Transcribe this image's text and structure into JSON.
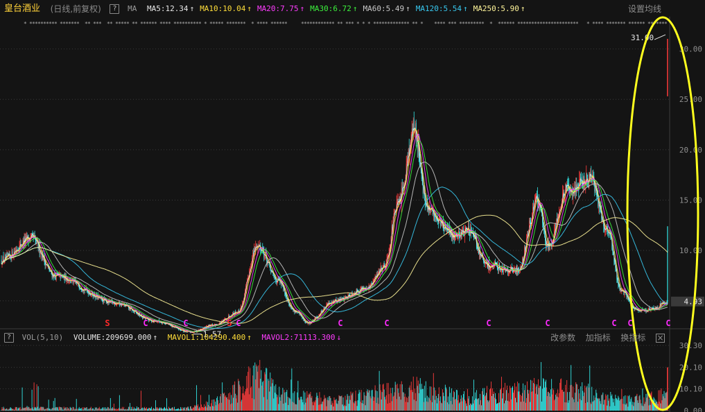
{
  "header": {
    "stock_name": "皇台酒业",
    "sub_label": "(日线,前复权)",
    "help_icon_text": "?",
    "ma_label": "MA",
    "settings_label": "设置均线"
  },
  "ma_legend": [
    {
      "text": "MA5:12.34",
      "arrow": "↑",
      "color": "#e8e8e8"
    },
    {
      "text": "MA10:10.04",
      "arrow": "↑",
      "color": "#ffde3a"
    },
    {
      "text": "MA20:7.75",
      "arrow": "↑",
      "color": "#ff3cff"
    },
    {
      "text": "MA30:6.72",
      "arrow": "↑",
      "color": "#3cf03c"
    },
    {
      "text": "MA60:5.49",
      "arrow": "↑",
      "color": "#c8c8c8"
    },
    {
      "text": "MA120:5.54",
      "arrow": "↑",
      "color": "#38c9f0"
    },
    {
      "text": "MA250:5.90",
      "arrow": "↑",
      "color": "#fff59a"
    }
  ],
  "volume_header": {
    "help_icon_text": "?",
    "label": "VOL(5,10)",
    "volume": {
      "text": "VOLUME:209699.000",
      "arrow": "↑",
      "color": "#e8e8e8"
    },
    "mavol1": {
      "text": "MAVOL1:104290.400",
      "arrow": "↑",
      "color": "#ffde3a"
    },
    "mavol2": {
      "text": "MAVOL2:71113.300",
      "arrow": "↓",
      "color": "#ff3cff"
    },
    "buttons": [
      "改参数",
      "加指标",
      "换指标"
    ],
    "close_text": "×"
  },
  "price_axis": {
    "min": 2.5,
    "max": 33,
    "ticks": [
      "30.00",
      "25.00",
      "20.00",
      "15.00",
      "10.00",
      "5.00"
    ],
    "tick_values": [
      30,
      25,
      20,
      15,
      10,
      5
    ]
  },
  "annotations": {
    "high_label": "31.00",
    "low_label": "1.57",
    "current_price": "4.93"
  },
  "event_markers": [
    "S",
    "C",
    "C",
    "S",
    "C",
    "C",
    "C",
    "C",
    "C",
    "C",
    "C",
    "C"
  ],
  "volume_axis": {
    "ticks": [
      "30.30",
      "20.10",
      "10.10",
      "0.00"
    ],
    "tick_values": [
      30.3,
      20.1,
      10.1,
      0.0
    ]
  },
  "colors": {
    "background": "#141414",
    "up": "#ff3d3d",
    "down": "#34e8e8",
    "grid": "#3a3a3a",
    "highlight_ellipse": "#ffff1e",
    "axis_text": "#8f8f8f"
  },
  "chart_data": {
    "type": "candlestick",
    "title": "皇台酒业 (日线,前复权)",
    "ylim": [
      2.5,
      33
    ],
    "price_keypoints": [
      {
        "t": 0.0,
        "p": 9.0
      },
      {
        "t": 0.045,
        "p": 11.2
      },
      {
        "t": 0.08,
        "p": 7.5
      },
      {
        "t": 0.17,
        "p": 4.8
      },
      {
        "t": 0.23,
        "p": 3.0
      },
      {
        "t": 0.285,
        "p": 1.9
      },
      {
        "t": 0.32,
        "p": 2.6
      },
      {
        "t": 0.355,
        "p": 3.9
      },
      {
        "t": 0.385,
        "p": 10.5
      },
      {
        "t": 0.415,
        "p": 7.0
      },
      {
        "t": 0.44,
        "p": 4.0
      },
      {
        "t": 0.46,
        "p": 2.8
      },
      {
        "t": 0.5,
        "p": 5.0
      },
      {
        "t": 0.55,
        "p": 6.3
      },
      {
        "t": 0.575,
        "p": 8.5
      },
      {
        "t": 0.595,
        "p": 14.5
      },
      {
        "t": 0.62,
        "p": 22.0
      },
      {
        "t": 0.64,
        "p": 14.0
      },
      {
        "t": 0.68,
        "p": 11.5
      },
      {
        "t": 0.7,
        "p": 12.0
      },
      {
        "t": 0.73,
        "p": 8.5
      },
      {
        "t": 0.775,
        "p": 8.0
      },
      {
        "t": 0.805,
        "p": 15.0
      },
      {
        "t": 0.82,
        "p": 10.5
      },
      {
        "t": 0.85,
        "p": 16.0
      },
      {
        "t": 0.885,
        "p": 17.0
      },
      {
        "t": 0.91,
        "p": 12.0
      },
      {
        "t": 0.93,
        "p": 6.0
      },
      {
        "t": 0.955,
        "p": 4.0
      },
      {
        "t": 0.98,
        "p": 4.2
      },
      {
        "t": 0.997,
        "p": 4.9
      }
    ],
    "volume_keypoints": [
      {
        "t": 0.0,
        "v": 1
      },
      {
        "t": 0.28,
        "v": 1
      },
      {
        "t": 0.32,
        "v": 3
      },
      {
        "t": 0.39,
        "v": 15
      },
      {
        "t": 0.42,
        "v": 6
      },
      {
        "t": 0.5,
        "v": 4
      },
      {
        "t": 0.62,
        "v": 9
      },
      {
        "t": 0.7,
        "v": 5
      },
      {
        "t": 0.8,
        "v": 9
      },
      {
        "t": 0.86,
        "v": 8
      },
      {
        "t": 0.93,
        "v": 4
      },
      {
        "t": 0.99,
        "v": 6
      }
    ],
    "volume_ylim": [
      0,
      30.3
    ],
    "spike": {
      "high": 31.0,
      "open": 30.8,
      "close": 25.3
    },
    "last_volume_spike": 20.1
  }
}
